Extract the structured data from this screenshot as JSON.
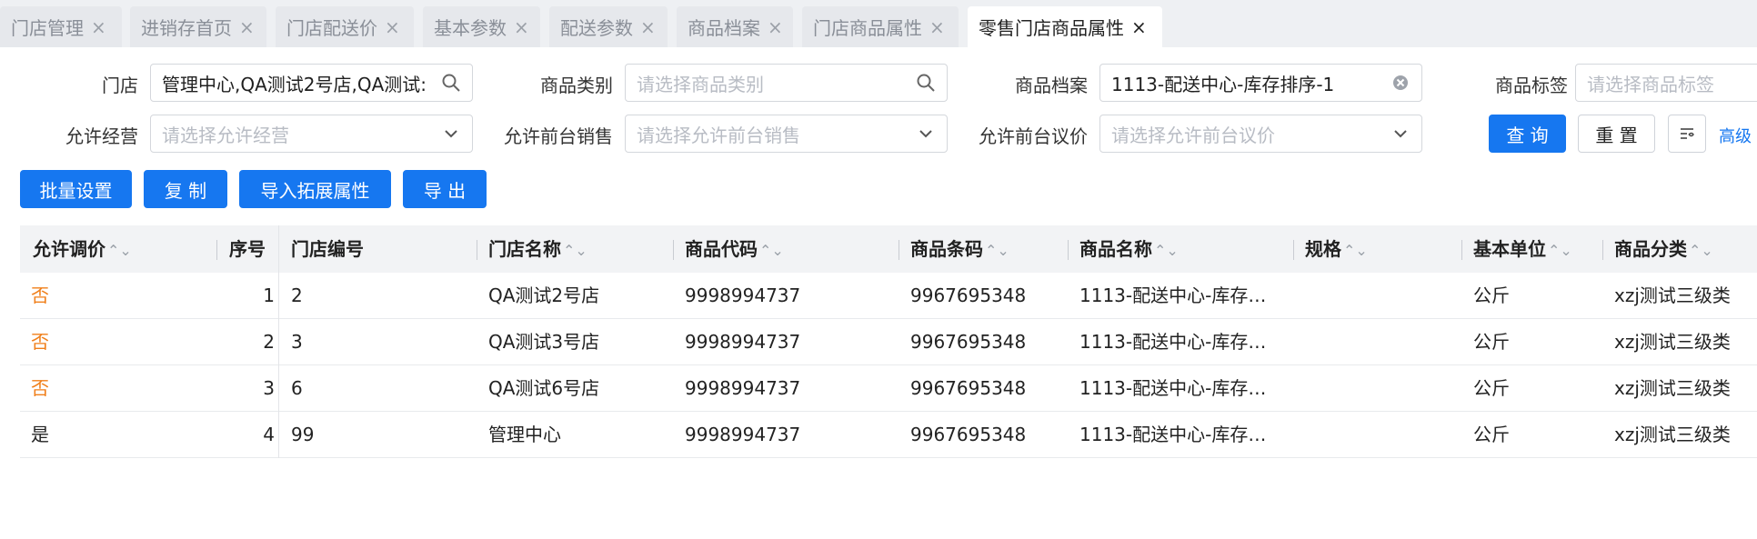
{
  "tabs": [
    {
      "label": "门店管理",
      "active": false
    },
    {
      "label": "进销存首页",
      "active": false
    },
    {
      "label": "门店配送价",
      "active": false
    },
    {
      "label": "基本参数",
      "active": false
    },
    {
      "label": "配送参数",
      "active": false
    },
    {
      "label": "商品档案",
      "active": false
    },
    {
      "label": "门店商品属性",
      "active": false
    },
    {
      "label": "零售门店商品属性",
      "active": true
    }
  ],
  "close_glyph": "×",
  "filters": {
    "store": {
      "label": "门店",
      "value": "管理中心,QA测试2号店,QA测试:"
    },
    "category": {
      "label": "商品类别",
      "placeholder": "请选择商品类别"
    },
    "archive": {
      "label": "商品档案",
      "value": "1113-配送中心-库存排序-1"
    },
    "tag": {
      "label": "商品标签",
      "placeholder": "请选择商品标签"
    },
    "allow_business": {
      "label": "允许经营",
      "placeholder": "请选择允许经营"
    },
    "allow_front_sale": {
      "label": "允许前台销售",
      "placeholder": "请选择允许前台销售"
    },
    "allow_front_bargain": {
      "label": "允许前台议价",
      "placeholder": "请选择允许前台议价"
    }
  },
  "actions": {
    "query": "查 询",
    "reset": "重 置",
    "advanced": "高级",
    "batch_set": "批量设置",
    "copy": "复 制",
    "import_ext": "导入拓展属性",
    "export": "导 出"
  },
  "table": {
    "sort_glyph": "⌃⌄",
    "columns": [
      "允许调价",
      "序号",
      "门店编号",
      "门店名称",
      "商品代码",
      "商品条码",
      "商品名称",
      "规格",
      "基本单位",
      "商品分类"
    ],
    "rows": [
      {
        "allow_price_adjust": "否",
        "seq": "1",
        "store_no": "2",
        "store_name": "QA测试2号店",
        "code": "9998994737",
        "barcode": "9967695348",
        "name": "1113-配送中心-库存…",
        "spec": "",
        "unit": "公斤",
        "category": "xzj测试三级类"
      },
      {
        "allow_price_adjust": "否",
        "seq": "2",
        "store_no": "3",
        "store_name": "QA测试3号店",
        "code": "9998994737",
        "barcode": "9967695348",
        "name": "1113-配送中心-库存…",
        "spec": "",
        "unit": "公斤",
        "category": "xzj测试三级类"
      },
      {
        "allow_price_adjust": "否",
        "seq": "3",
        "store_no": "6",
        "store_name": "QA测试6号店",
        "code": "9998994737",
        "barcode": "9967695348",
        "name": "1113-配送中心-库存…",
        "spec": "",
        "unit": "公斤",
        "category": "xzj测试三级类"
      },
      {
        "allow_price_adjust": "是",
        "seq": "4",
        "store_no": "99",
        "store_name": "管理中心",
        "code": "9998994737",
        "barcode": "9967695348",
        "name": "1113-配送中心-库存…",
        "spec": "",
        "unit": "公斤",
        "category": "xzj测试三级类"
      }
    ]
  },
  "colors": {
    "primary": "#1677f0",
    "negative_value": "#f07f1a"
  }
}
